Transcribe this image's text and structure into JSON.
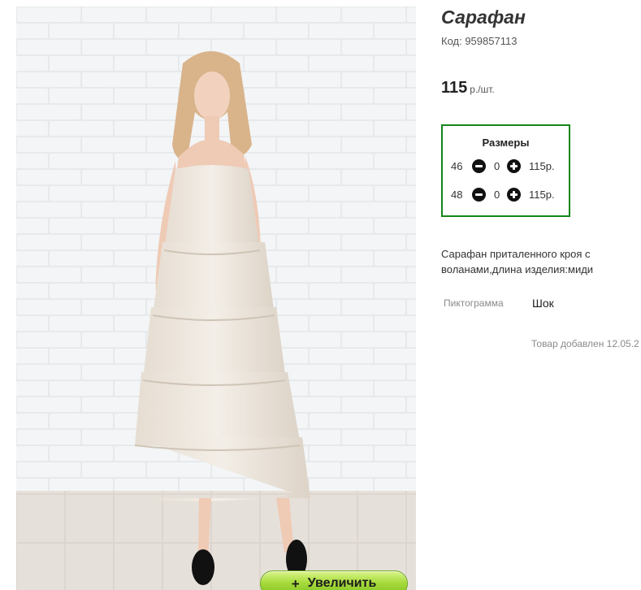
{
  "product": {
    "title": "Сарафан",
    "code": "Код: 959857113",
    "price": "115",
    "price_unit": "р./шт.",
    "description": "Сарафан приталенного кроя с воланами,длина изделия:миди",
    "attribute": {
      "label": "Пиктограмма",
      "value": "Шок"
    },
    "added": "Товар добавлен 12.05.2"
  },
  "sizes": {
    "title": "Размеры",
    "rows": [
      {
        "size": "46",
        "qty": "0",
        "price": "115р."
      },
      {
        "size": "48",
        "qty": "0",
        "price": "115р."
      }
    ]
  },
  "photo": {
    "zoom_icon": "+",
    "zoom_label": "Увеличить"
  },
  "colors": {
    "sizes_border": "#16861a",
    "zoom_button": "#a9dc3e"
  },
  "icons": [
    "minus-circle-icon",
    "plus-circle-icon",
    "plus-icon"
  ]
}
